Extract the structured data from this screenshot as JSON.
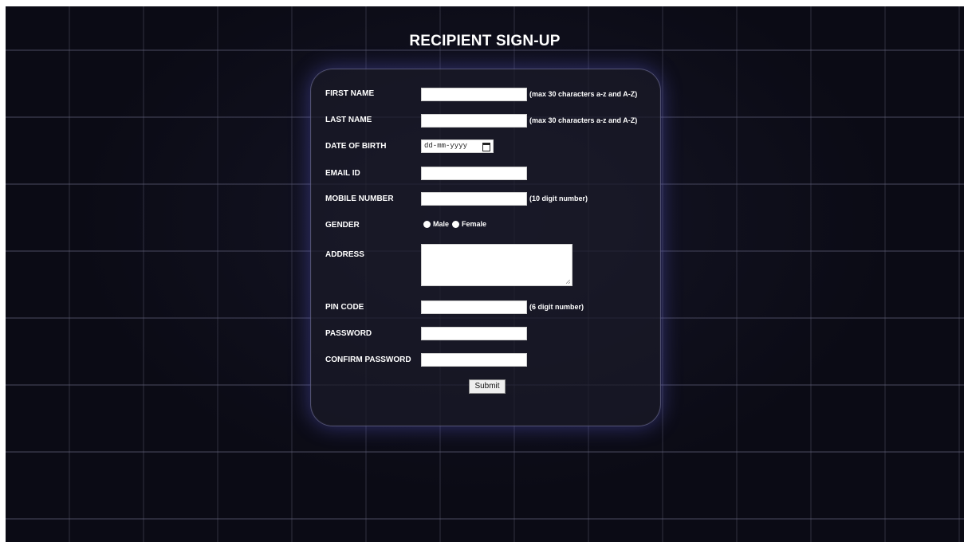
{
  "page": {
    "title": "RECIPIENT SIGN-UP"
  },
  "form": {
    "first_name": {
      "label": "FIRST NAME",
      "value": "",
      "hint": "(max 30 characters a-z and A-Z)"
    },
    "last_name": {
      "label": "LAST NAME",
      "value": "",
      "hint": "(max 30 characters a-z and A-Z)"
    },
    "dob": {
      "label": "DATE OF BIRTH",
      "placeholder": "dd-mm-yyyy",
      "icon": "calendar-icon"
    },
    "email": {
      "label": "EMAIL ID",
      "value": ""
    },
    "mobile": {
      "label": "MOBILE NUMBER",
      "value": "",
      "hint": "(10 digit number)"
    },
    "gender": {
      "label": "GENDER",
      "options": [
        "Male",
        "Female"
      ]
    },
    "address": {
      "label": "ADDRESS",
      "value": ""
    },
    "pin": {
      "label": "PIN CODE",
      "value": "",
      "hint": "(6 digit number)"
    },
    "password": {
      "label": "PASSWORD",
      "value": ""
    },
    "confirm_password": {
      "label": "CONFIRM PASSWORD",
      "value": ""
    },
    "submit_label": "Submit"
  },
  "colors": {
    "background": "#0b0b15",
    "text": "#ffffff",
    "card_glow": "#6e6eff"
  }
}
